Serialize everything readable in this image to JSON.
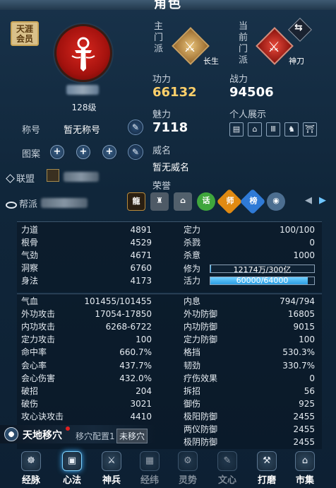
{
  "window": {
    "title": "角色"
  },
  "vip_badge": {
    "text": "天涯会员"
  },
  "character": {
    "level": "128级"
  },
  "schools": {
    "main_label": "主门派",
    "main_name": "长生",
    "current_label": "当前门派",
    "current_name": "神刀"
  },
  "profile": {
    "title_label": "称号",
    "title_value": "暂无称号",
    "pattern_label": "图案",
    "alliance_label": "联盟",
    "guild_label": "帮派"
  },
  "stats_top": {
    "kungfu_label": "功力",
    "kungfu_value": "66132",
    "combat_label": "战力",
    "combat_value": "94506",
    "charm_label": "魅力",
    "charm_value": "7118",
    "showcase_label": "个人展示",
    "fame_label": "威名",
    "fame_value": "暂无威名",
    "honor_label": "荣誉"
  },
  "honor_badges": [
    "话",
    "师",
    "榜"
  ],
  "attributes": [
    {
      "label": "力道",
      "value": "4891"
    },
    {
      "label": "根骨",
      "value": "4529"
    },
    {
      "label": "气劲",
      "value": "4671"
    },
    {
      "label": "洞察",
      "value": "6760"
    },
    {
      "label": "身法",
      "value": "4173"
    }
  ],
  "attributes_right": [
    {
      "label": "定力",
      "value": "100/100"
    },
    {
      "label": "杀戮",
      "value": "0"
    },
    {
      "label": "杀意",
      "value": "1000"
    }
  ],
  "cultivation": {
    "label": "修为",
    "text": "12174万/300亿",
    "fill": 0.0041
  },
  "vitality": {
    "label": "活力",
    "text": "60000/64000",
    "fill": 0.9375
  },
  "combat_left": [
    {
      "label": "气血",
      "value": "101455/101455"
    },
    {
      "label": "外功攻击",
      "value": "17054-17850"
    },
    {
      "label": "内功攻击",
      "value": "6268-6722"
    },
    {
      "label": "定力攻击",
      "value": "100"
    },
    {
      "label": "命中率",
      "value": "660.7%"
    },
    {
      "label": "会心率",
      "value": "437.7%"
    },
    {
      "label": "会心伤害",
      "value": "432.0%"
    },
    {
      "label": "破招",
      "value": "204"
    },
    {
      "label": "破伤",
      "value": "3021"
    },
    {
      "label": "攻心诀攻击",
      "value": "4410"
    }
  ],
  "combat_right": [
    {
      "label": "内息",
      "value": "794/794"
    },
    {
      "label": "外功防御",
      "value": "16805"
    },
    {
      "label": "内功防御",
      "value": "9015"
    },
    {
      "label": "定力防御",
      "value": "100"
    },
    {
      "label": "格挡",
      "value": "530.3%"
    },
    {
      "label": "韧劲",
      "value": "330.7%"
    },
    {
      "label": "疗伤效果",
      "value": "0"
    },
    {
      "label": "拆招",
      "value": "56"
    },
    {
      "label": "御伤",
      "value": "925"
    },
    {
      "label": "极阳防御",
      "value": "2455"
    },
    {
      "label": "两仪防御",
      "value": "2455"
    },
    {
      "label": "极阴防御",
      "value": "2455"
    }
  ],
  "acupoint": {
    "title": "天地移穴",
    "config_label": "移穴配置1",
    "status": "未移穴"
  },
  "nav": [
    {
      "label": "经脉",
      "icon": "☸"
    },
    {
      "label": "心法",
      "icon": "▣"
    },
    {
      "label": "神兵",
      "icon": "⚔"
    },
    {
      "label": "经纬",
      "icon": "▦"
    },
    {
      "label": "灵势",
      "icon": "⚙"
    },
    {
      "label": "文心",
      "icon": "✎"
    },
    {
      "label": "打磨",
      "icon": "⚒"
    },
    {
      "label": "市集",
      "icon": "⌂"
    }
  ],
  "colors": {
    "accent_gold": "#ffd06a",
    "bar_blue": "#35aef0",
    "portrait_red": "#c81c16"
  }
}
